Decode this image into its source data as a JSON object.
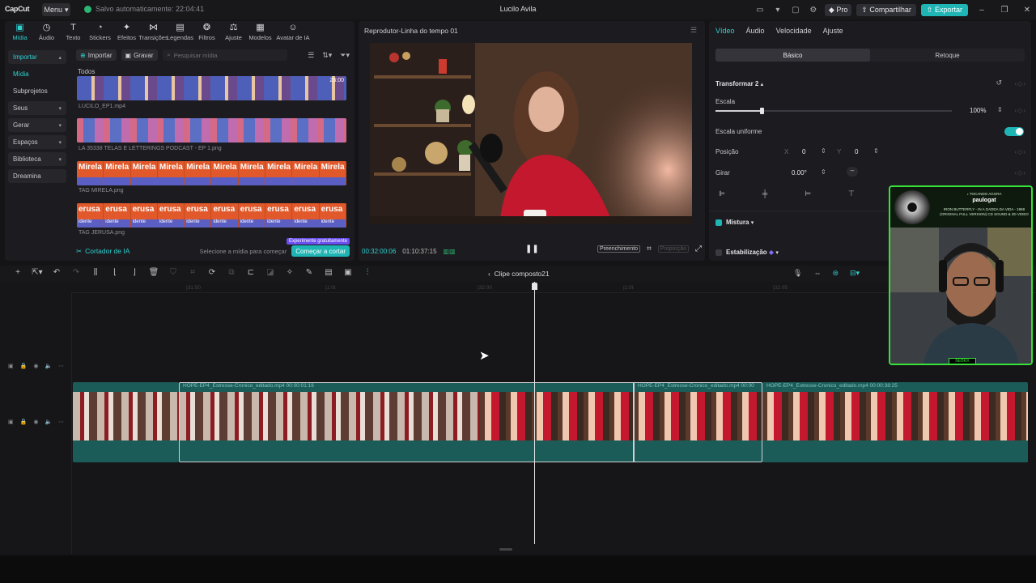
{
  "titlebar": {
    "logo": "CapCut",
    "menu": "Menu",
    "autosave": "Salvo automaticamente: 22:04:41",
    "project": "Lucilo Avila",
    "pro": "Pro",
    "share": "Compartilhar",
    "export": "Exportar"
  },
  "toolbar": {
    "tabs": [
      {
        "label": "Mídia",
        "icon": "media-icon"
      },
      {
        "label": "Áudio",
        "icon": "audio-icon"
      },
      {
        "label": "Texto",
        "icon": "text-icon"
      },
      {
        "label": "Stickers",
        "icon": "sticker-icon"
      },
      {
        "label": "Efeitos",
        "icon": "effects-icon"
      },
      {
        "label": "Transições",
        "icon": "transitions-icon"
      },
      {
        "label": "Legendas",
        "icon": "captions-icon"
      },
      {
        "label": "Filtros",
        "icon": "filters-icon"
      },
      {
        "label": "Ajuste",
        "icon": "adjust-icon"
      },
      {
        "label": "Modelos",
        "icon": "templates-icon"
      },
      {
        "label": "Avatar de IA",
        "icon": "ai-avatar-icon"
      }
    ]
  },
  "sidebar": {
    "items": [
      {
        "label": "Importar"
      },
      {
        "label": "Mídia"
      },
      {
        "label": "Subprojetos"
      },
      {
        "label": "Seus"
      },
      {
        "label": "Gerar"
      },
      {
        "label": "Espaços"
      },
      {
        "label": "Biblioteca"
      },
      {
        "label": "Dreamina"
      }
    ]
  },
  "media": {
    "import": "Importar",
    "record": "Gravar",
    "search_placeholder": "Pesquisar mídia",
    "section": "Todos",
    "items": [
      {
        "name": "LUCILO_EP1.mp4",
        "duration": "26:00"
      },
      {
        "name": "LA 35338 TELAS E LETTERINGS PODCAST - EP 1.png"
      },
      {
        "name": "TAG MIRELA.png",
        "word": "Mirela"
      },
      {
        "name": "TAG JERUSA.png",
        "word": "erusa",
        "sub": "idente"
      }
    ]
  },
  "ai_cutter": {
    "label": "Cortador de IA",
    "hint": "Selecione a mídia para começar",
    "button": "Começar a cortar",
    "badge": "Experimente gratuitamente"
  },
  "player": {
    "title": "Reprodutor-Linha do tempo 01",
    "current": "00:32:00:06",
    "total": "01:10:37:15",
    "fill": "Preenchimento",
    "proportion": "Proporção"
  },
  "props": {
    "tabs": [
      "Vídeo",
      "Áudio",
      "Velocidade",
      "Ajuste"
    ],
    "segments": [
      "Básico",
      "Retoque"
    ],
    "transform": "Transformar 2",
    "scale_label": "Escala",
    "scale_value": "100%",
    "scale_fraction": 0.2,
    "uniform": "Escala uniforme",
    "position": "Posição",
    "pos_x_label": "X",
    "pos_x": "0",
    "pos_y_label": "Y",
    "pos_y": "0",
    "rotate": "Girar",
    "rotate_value": "0.00°",
    "blend": "Mistura",
    "stabilize": "Estabilização"
  },
  "timeline": {
    "compound": "Clipe composto21",
    "ruler": [
      "|31:50",
      "|1:0t",
      "|32:00",
      "|1:0t",
      "|32:05"
    ],
    "clips": [
      {
        "label": ""
      },
      {
        "label": "HOPE-EP4_Estresse-Cronico_editado.mp4   00:00:01:16"
      },
      {
        "label": "HOPE-EP4_Estresse-Cronico_editado.mp4   00:00"
      },
      {
        "label": "HOPE-EP4_Estresse-Cronico_editado.mp4   00:00:38:25"
      }
    ]
  },
  "webcam": {
    "now_playing": "♪ TOCANDO AGORA",
    "artist": "paulogat",
    "song": "IRON BUTTERFLY - IN A GADDA DA VIDA - 1968 (ORIGINAL FULL VERSION) CD SOUND & 3D VIDEO",
    "tag": "NEBRX"
  },
  "colors": {
    "accent": "#1fb5b5",
    "webcam_border": "#39e039"
  }
}
